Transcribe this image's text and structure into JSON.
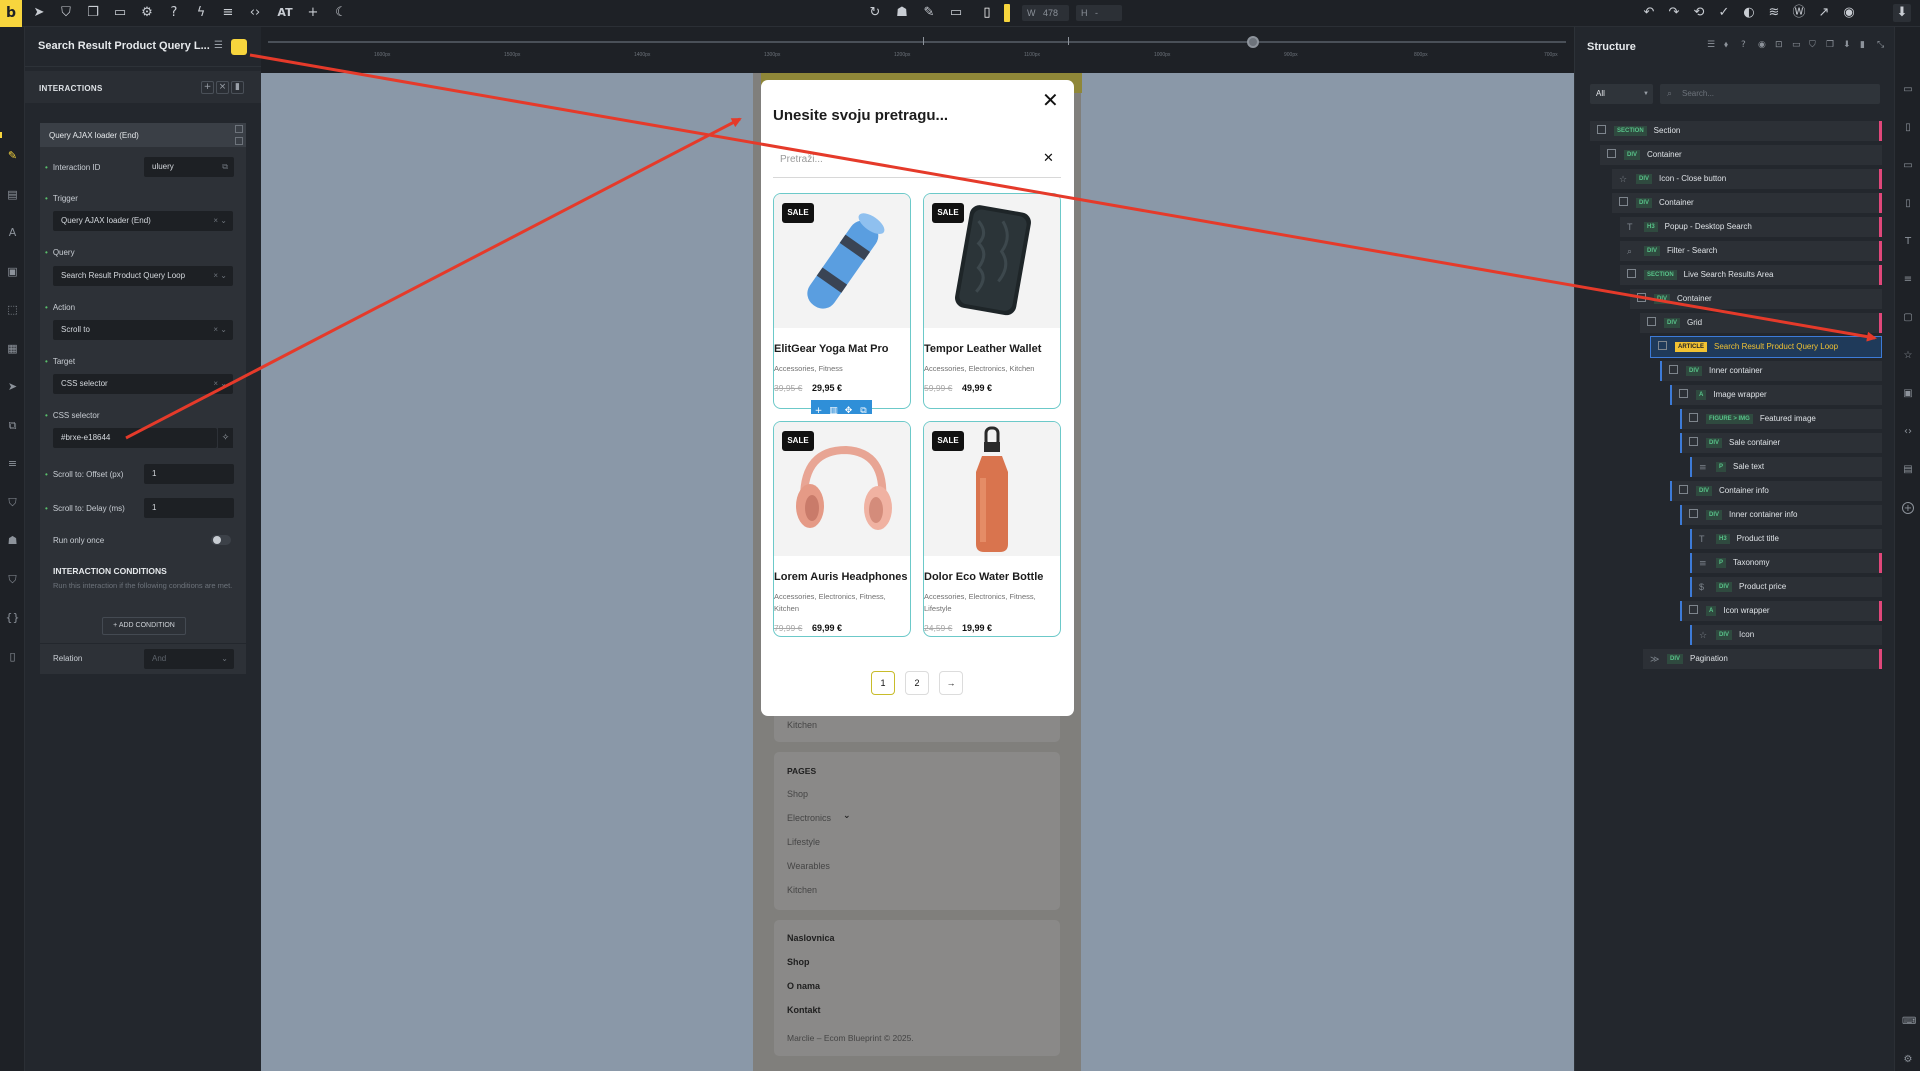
{
  "topbar": {
    "logo": "b",
    "width_label": "W",
    "width_value": "478",
    "height_label": "H",
    "height_value": "-",
    "at_label": "AT"
  },
  "left_panel": {
    "title": "Search Result Product Query L...",
    "section_title": "INTERACTIONS",
    "interaction_name": "Query AJAX loader (End)",
    "interaction_id_label": "Interaction ID",
    "interaction_id_value": "uluery",
    "trigger_label": "Trigger",
    "trigger_value": "Query AJAX loader (End)",
    "query_label": "Query",
    "query_value": "Search Result Product Query Loop",
    "action_label": "Action",
    "action_value": "Scroll to",
    "target_label": "Target",
    "target_value": "CSS selector",
    "css_selector_label": "CSS selector",
    "css_selector_value": "#brxe-e18644",
    "offset_label": "Scroll to: Offset (px)",
    "offset_value": "1",
    "delay_label": "Scroll to: Delay (ms)",
    "delay_value": "1",
    "run_once_label": "Run only once",
    "conditions_title": "INTERACTION CONDITIONS",
    "conditions_desc": "Run this interaction if the following conditions are met.",
    "add_condition_label": "+ ADD CONDITION",
    "relation_label": "Relation",
    "relation_value": "And"
  },
  "ruler": {
    "ticks": [
      "1600px",
      "1500px",
      "1400px",
      "1300px",
      "1200px",
      "1100px",
      "1000px",
      "900px",
      "800px",
      "700px"
    ]
  },
  "modal": {
    "title": "Unesite svoju pretragu...",
    "search_placeholder": "Pretraži...",
    "products": [
      {
        "title": "ElitGear Yoga Mat Pro",
        "taxonomy": "Accessories, Fitness",
        "old_price": "39,95 €",
        "price": "29,95 €",
        "sale": "SALE"
      },
      {
        "title": "Tempor Leather Wallet",
        "taxonomy": "Accessories, Electronics, Kitchen",
        "old_price": "59,99 €",
        "price": "49,99 €",
        "sale": "SALE"
      },
      {
        "title": "Lorem Auris Headphones",
        "taxonomy": "Accessories, Electronics, Fitness, Kitchen",
        "old_price": "79,99 €",
        "price": "69,99 €",
        "sale": "SALE"
      },
      {
        "title": "Dolor Eco Water Bottle",
        "taxonomy": "Accessories, Electronics, Fitness, Lifestyle",
        "old_price": "24,59 €",
        "price": "19,99 €",
        "sale": "SALE"
      }
    ],
    "pagination": [
      "1",
      "2",
      "→"
    ]
  },
  "page_behind": {
    "kitchen_top": "Kitchen",
    "pages_title": "PAGES",
    "pages_links": [
      "Shop",
      "Electronics",
      "Lifestyle",
      "Wearables",
      "Kitchen"
    ],
    "nav_links": [
      "Naslovnica",
      "Shop",
      "O nama",
      "Kontakt"
    ],
    "copyright": "Marclie – Ecom Blueprint © 2025."
  },
  "structure": {
    "title": "Structure",
    "filter_value": "All",
    "search_placeholder": "Search...",
    "rows": [
      {
        "tag": "SECTION",
        "label": "Section"
      },
      {
        "tag": "DIV",
        "label": "Container"
      },
      {
        "tag": "DIV",
        "label": "Icon - Close button"
      },
      {
        "tag": "DIV",
        "label": "Container"
      },
      {
        "tag": "H3",
        "label": "Popup - Desktop Search"
      },
      {
        "tag": "DIV",
        "label": "Filter - Search"
      },
      {
        "tag": "SECTION",
        "label": "Live Search Results Area"
      },
      {
        "tag": "DIV",
        "label": "Container"
      },
      {
        "tag": "DIV",
        "label": "Grid"
      },
      {
        "tag": "ARTICLE",
        "label": "Search Result Product Query Loop"
      },
      {
        "tag": "DIV",
        "label": "Inner container"
      },
      {
        "tag": "A",
        "label": "Image wrapper"
      },
      {
        "tag": "FIGURE > IMG",
        "label": "Featured image"
      },
      {
        "tag": "DIV",
        "label": "Sale container"
      },
      {
        "tag": "P",
        "label": "Sale text"
      },
      {
        "tag": "DIV",
        "label": "Container info"
      },
      {
        "tag": "DIV",
        "label": "Inner container info"
      },
      {
        "tag": "H3",
        "label": "Product title"
      },
      {
        "tag": "P",
        "label": "Taxonomy"
      },
      {
        "tag": "DIV",
        "label": "Product price"
      },
      {
        "tag": "A",
        "label": "Icon wrapper"
      },
      {
        "tag": "DIV",
        "label": "Icon"
      },
      {
        "tag": "DIV",
        "label": "Pagination"
      }
    ]
  },
  "colors": {
    "accent_yellow": "#f7d53d",
    "arrow_red": "#e53a2a",
    "selection_blue": "#2f8fd8",
    "product_border": "#6cc9c9"
  }
}
